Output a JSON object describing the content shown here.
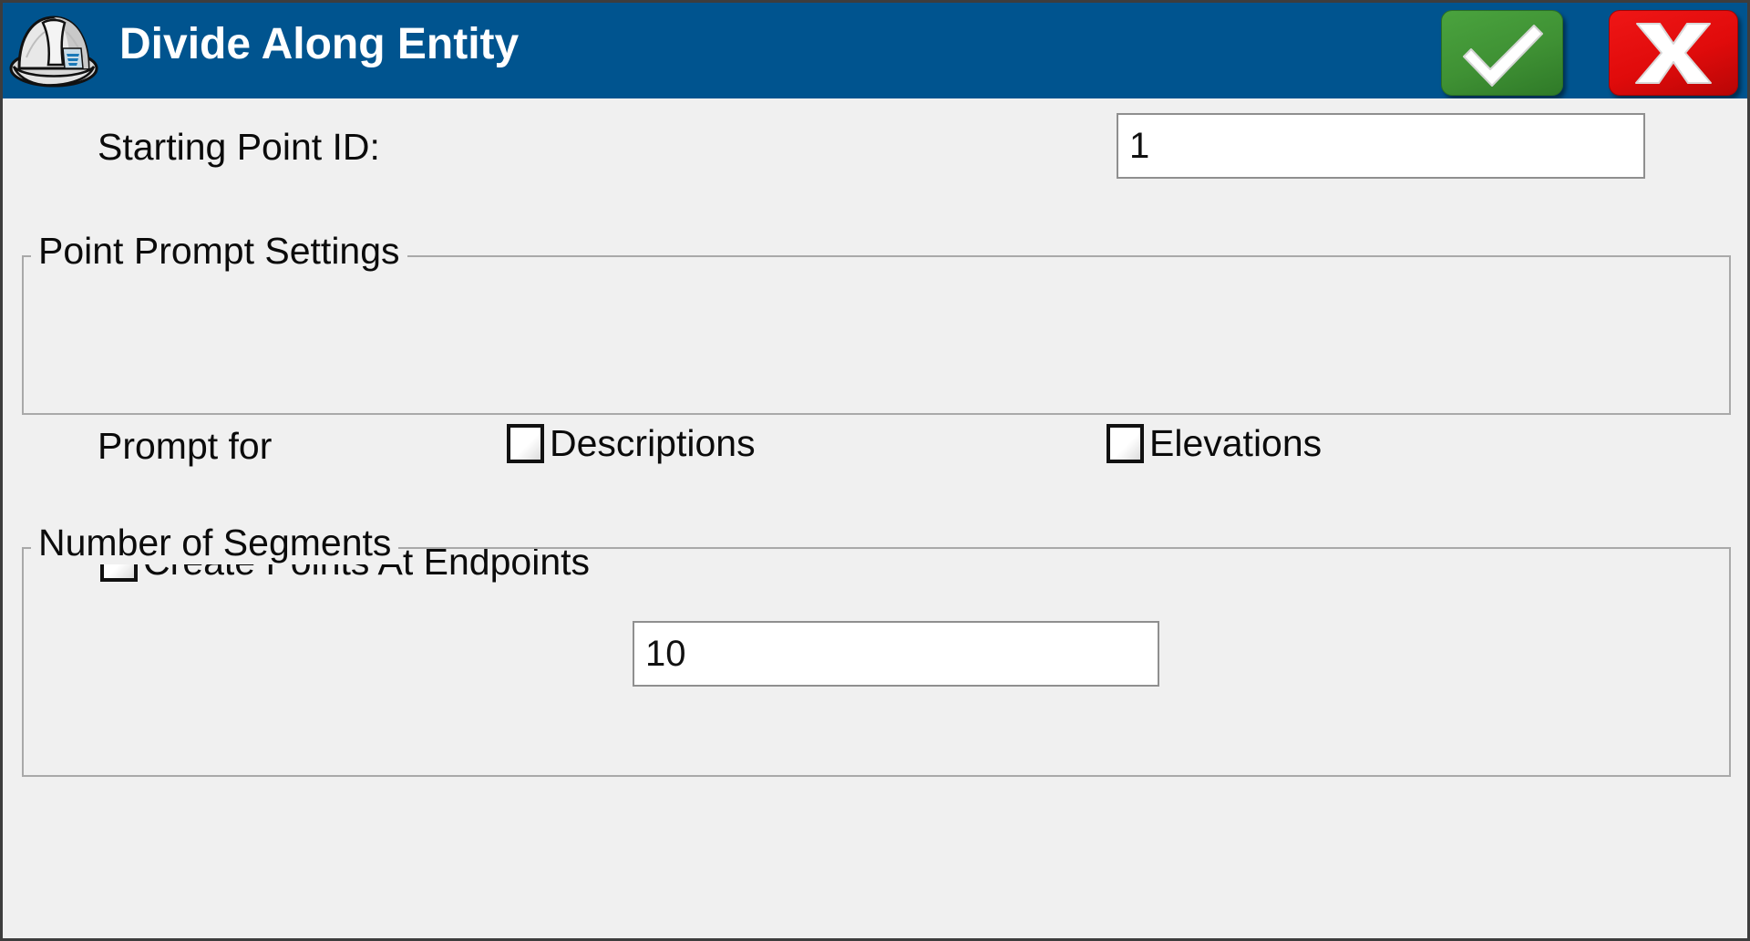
{
  "window": {
    "title": "Divide Along Entity",
    "app_icon": "hard-hat-icon"
  },
  "titlebar": {
    "ok_label": "OK",
    "ok_icon": "checkmark-icon",
    "cancel_label": "Cancel",
    "cancel_icon": "x-icon"
  },
  "colors": {
    "titlebar_blue": "#00548f",
    "ok_green": "#3f9134",
    "cancel_red": "#e00b0b",
    "dialog_background": "#f0f0f0",
    "input_background": "#ffffff",
    "group_border": "#a9a9a9",
    "text": "#0b0b0b"
  },
  "fields": {
    "starting_point": {
      "label": "Starting Point ID:",
      "value": "1",
      "placeholder": ""
    },
    "number_of_segments": {
      "label": "Number of Segments",
      "value": "10",
      "placeholder": ""
    }
  },
  "point_prompt_settings": {
    "legend": "Point Prompt Settings",
    "prompt_for_label": "Prompt for",
    "checkboxes": [
      {
        "label": "Descriptions",
        "checked": false
      },
      {
        "label": "Elevations",
        "checked": false
      }
    ]
  },
  "create_points_at_endpoints": {
    "label": "Create Points At Endpoints",
    "checked": false
  }
}
